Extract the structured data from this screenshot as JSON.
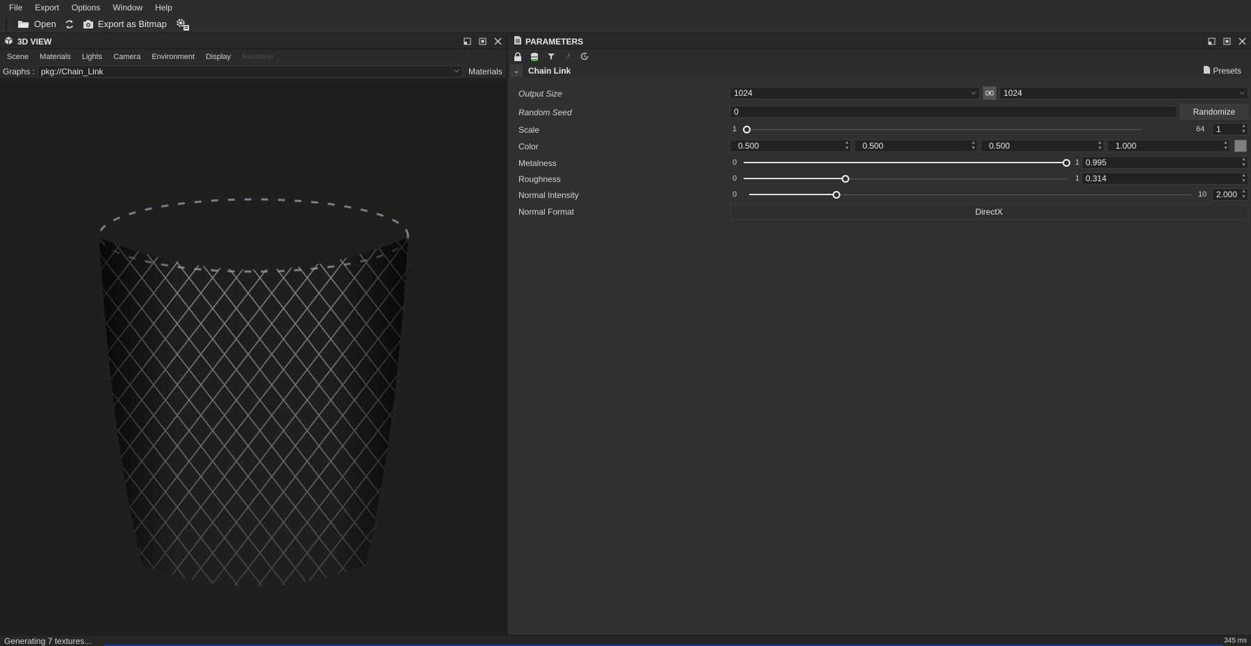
{
  "menu": [
    "File",
    "Export",
    "Options",
    "Window",
    "Help"
  ],
  "toolbar": {
    "open_label": "Open",
    "export_label": "Export as Bitmap"
  },
  "view3d": {
    "title": "3D VIEW",
    "tabs": [
      "Scene",
      "Materials",
      "Lights",
      "Camera",
      "Environment",
      "Display",
      "Renderer"
    ],
    "graphs_label": "Graphs :",
    "graphs_value": "pkg://Chain_Link",
    "materials_label": "Materials"
  },
  "params": {
    "title": "PARAMETERS",
    "section_title": "Chain Link",
    "presets_label": "Presets",
    "output_size": {
      "label": "Output Size",
      "width": "1024",
      "height": "1024"
    },
    "random_seed": {
      "label": "Random Seed",
      "value": "0",
      "button": "Randomize"
    },
    "scale": {
      "label": "Scale",
      "min": "1",
      "max": "64",
      "value": "1",
      "fraction": 0.0
    },
    "color": {
      "label": "Color",
      "r": "0.500",
      "g": "0.500",
      "b": "0.500",
      "a": "1.000",
      "swatch": "#808080"
    },
    "metalness": {
      "label": "Metalness",
      "min": "0",
      "max": "1",
      "value": "0.995",
      "fraction": 0.995
    },
    "roughness": {
      "label": "Roughness",
      "min": "0",
      "max": "1",
      "value": "0.314",
      "fraction": 0.314
    },
    "normal_intensity": {
      "label": "Normal Intensity",
      "min": "0",
      "max": "10",
      "value": "2.000",
      "fraction": 0.2
    },
    "normal_format": {
      "label": "Normal Format",
      "value": "DirectX"
    }
  },
  "status": {
    "message": "Generating 7 textures...",
    "time": "345 ms"
  },
  "colors": {
    "accent": "#1f3a8a",
    "background": "#2b2b2b"
  }
}
